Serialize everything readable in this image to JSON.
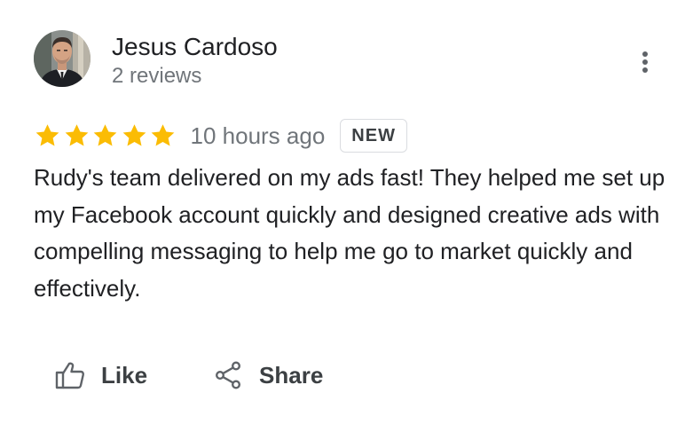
{
  "reviewer": {
    "name": "Jesus Cardoso",
    "review_count": "2 reviews",
    "avatar_icon": "profile-photo"
  },
  "menu": {
    "icon": "more-vert-icon"
  },
  "rating": {
    "stars": 5,
    "max_stars": 5,
    "star_color": "#fbbc04",
    "time_ago": "10 hours ago",
    "badge": "NEW"
  },
  "review": {
    "text": "Rudy's team delivered on my ads fast! They helped me set up my Facebook account quickly and designed creative ads with compelling messaging to help me go to market quickly and effectively."
  },
  "actions": {
    "like_label": "Like",
    "like_icon": "thumb-up-icon",
    "share_label": "Share",
    "share_icon": "share-icon"
  },
  "colors": {
    "text_primary": "#202124",
    "text_secondary": "#70757a",
    "icon_gray": "#5f6368"
  }
}
